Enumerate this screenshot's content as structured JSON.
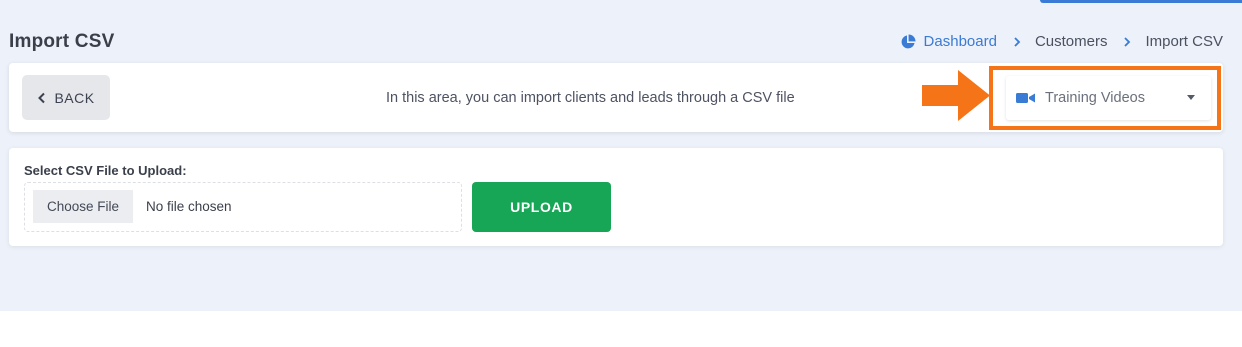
{
  "header": {
    "title": "Import CSV",
    "breadcrumb": [
      {
        "label": "Dashboard",
        "icon": "pie-chart-icon",
        "link": true
      },
      {
        "label": "Customers",
        "link": false
      },
      {
        "label": "Import CSV",
        "link": false
      }
    ]
  },
  "toolbar": {
    "back_label": "BACK",
    "info_text": "In this area, you can import clients and leads through a CSV file",
    "training_select": {
      "icon": "video-camera-icon",
      "value": "Training Videos"
    }
  },
  "upload": {
    "label": "Select CSV File to Upload:",
    "choose_label": "Choose File",
    "file_status": "No file chosen",
    "upload_label": "UPLOAD"
  },
  "colors": {
    "accent": "#3a7bd5",
    "highlight": "#f47417",
    "upload_button": "#17a656",
    "background": "#edf1f9"
  }
}
